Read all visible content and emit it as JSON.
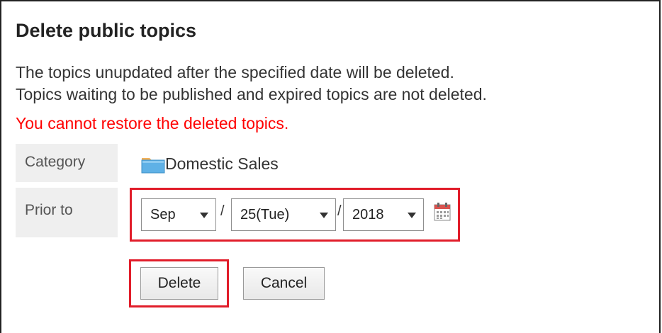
{
  "dialog": {
    "title": "Delete public topics",
    "description_line1": "The topics unupdated after the specified date will be deleted.",
    "description_line2": "Topics waiting to be published and expired topics are not deleted.",
    "warning": "You cannot restore the deleted topics."
  },
  "form": {
    "category_label": "Category",
    "category_value": "Domestic Sales",
    "category_icon": "folder-icon",
    "prior_label": "Prior to",
    "month": "Sep",
    "day": "25(Tue)",
    "year": "2018",
    "separator": "/",
    "calendar_icon": "calendar-icon"
  },
  "buttons": {
    "delete_label": "Delete",
    "cancel_label": "Cancel"
  },
  "colors": {
    "warning": "#ff0000",
    "highlight": "#e11d2a",
    "label_bg": "#efefef",
    "folder": "#5fb1e6"
  }
}
